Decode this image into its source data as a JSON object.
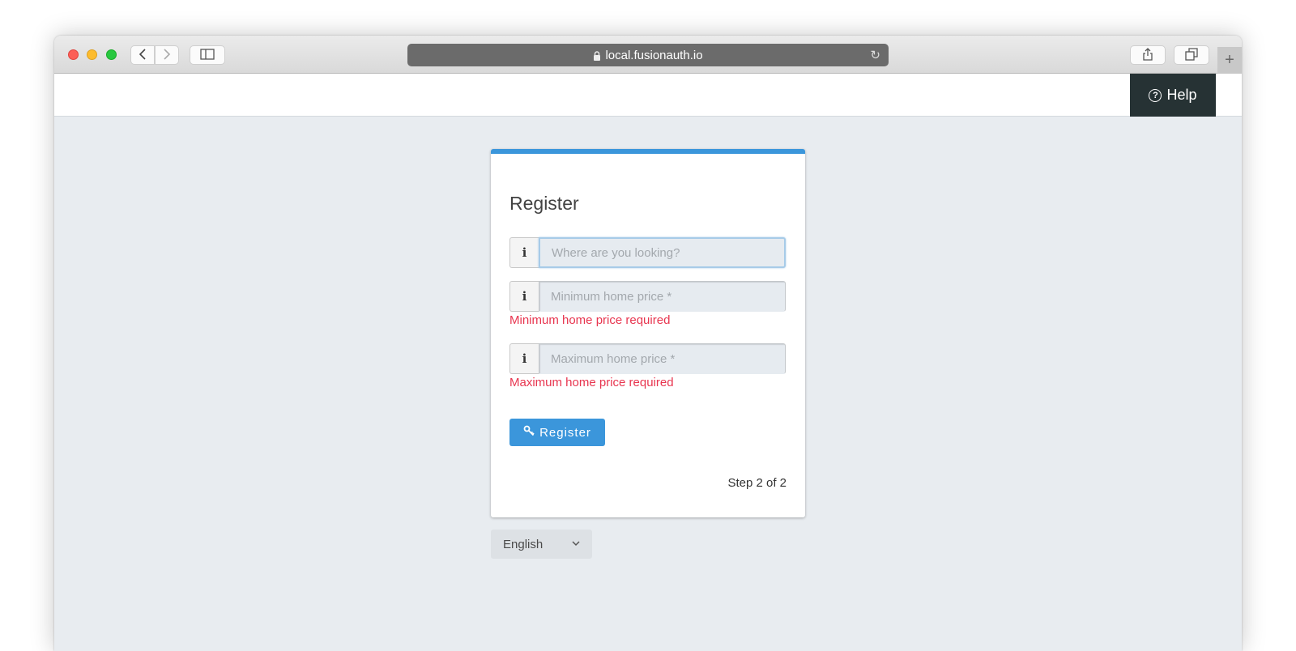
{
  "browser": {
    "url": "local.fusionauth.io",
    "back_icon": "‹",
    "forward_icon": "›",
    "new_tab_icon": "+",
    "reload_icon": "↻"
  },
  "header": {
    "help_label": "Help",
    "help_icon": "?"
  },
  "form": {
    "title": "Register",
    "fields": [
      {
        "placeholder": "Where are you looking?",
        "value": "",
        "icon": "i",
        "error": ""
      },
      {
        "placeholder": "Minimum home price *",
        "value": "",
        "icon": "i",
        "error": "Minimum home price required"
      },
      {
        "placeholder": "Maximum home price *",
        "value": "",
        "icon": "i",
        "error": "Maximum home price required"
      }
    ],
    "submit_label": "Register",
    "step_text": "Step 2 of 2"
  },
  "locale": {
    "selected": "English",
    "chevron": "⌄"
  },
  "colors": {
    "accent": "#3b96db",
    "error": "#e8354f",
    "help_bg": "#263234",
    "page_bg": "#e8ecf0"
  }
}
